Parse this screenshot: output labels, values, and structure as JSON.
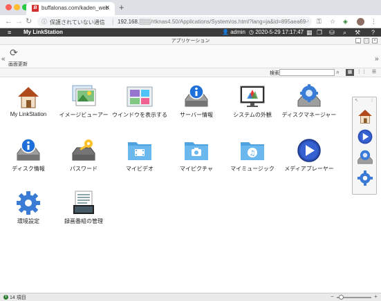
{
  "browser": {
    "tab_title": "buffalonas.com/kaden_web",
    "tab_favicon": "B",
    "new_tab": "+",
    "security_text": "保護されていない通信",
    "url_host": "192.168.",
    "url_rest": "/rtknas4.50/Applications/System/os.html?lang=ja&id=895aea69-94..."
  },
  "header": {
    "menu_icon": "≡",
    "app_name": "My LinkStation",
    "user": "admin",
    "datetime": "2020-5-29 17:17:47"
  },
  "window": {
    "title": "アプリケーション"
  },
  "toolbar": {
    "refresh_label": "画面更新"
  },
  "search": {
    "label": "検索",
    "value": ""
  },
  "apps": [
    {
      "label": "My LinkStation",
      "icon": "home-icon"
    },
    {
      "label": "イメージビューアー",
      "icon": "image-viewer-icon"
    },
    {
      "label": "ウインドウを表示する",
      "icon": "windows-icon"
    },
    {
      "label": "サーバー情報",
      "icon": "server-info-icon"
    },
    {
      "label": "システムの外観",
      "icon": "system-appearance-icon"
    },
    {
      "label": "ディスクマネージャー",
      "icon": "disk-manager-icon"
    },
    {
      "label": "ディスク情報",
      "icon": "disk-info-icon"
    },
    {
      "label": "パスワード",
      "icon": "password-icon"
    },
    {
      "label": "マイビデオ",
      "icon": "my-video-icon"
    },
    {
      "label": "マイピクチャ",
      "icon": "my-picture-icon"
    },
    {
      "label": "マイミュージック",
      "icon": "my-music-icon"
    },
    {
      "label": "メディアプレーヤー",
      "icon": "media-player-icon"
    },
    {
      "label": "環境設定",
      "icon": "settings-icon"
    },
    {
      "label": "録画番組の管理",
      "icon": "recording-manager-icon"
    }
  ],
  "status": {
    "count_text": "14 項目"
  },
  "colors": {
    "header_bg": "#3b3b3b",
    "accent_blue": "#2f7ed8",
    "folder_blue": "#4fa3e0"
  }
}
